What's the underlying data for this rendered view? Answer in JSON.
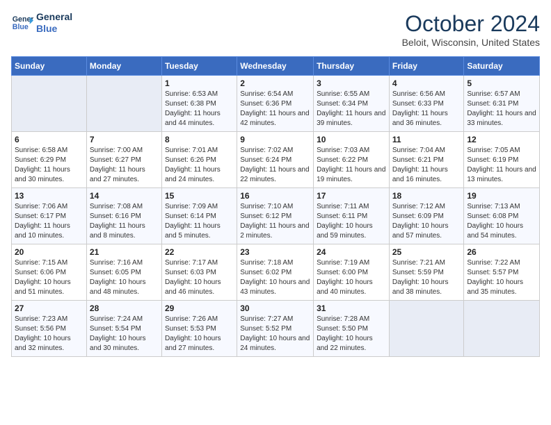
{
  "logo": {
    "line1": "General",
    "line2": "Blue"
  },
  "title": "October 2024",
  "location": "Beloit, Wisconsin, United States",
  "weekdays": [
    "Sunday",
    "Monday",
    "Tuesday",
    "Wednesday",
    "Thursday",
    "Friday",
    "Saturday"
  ],
  "weeks": [
    [
      {
        "day": "",
        "sunrise": "",
        "sunset": "",
        "daylight": ""
      },
      {
        "day": "",
        "sunrise": "",
        "sunset": "",
        "daylight": ""
      },
      {
        "day": "1",
        "sunrise": "Sunrise: 6:53 AM",
        "sunset": "Sunset: 6:38 PM",
        "daylight": "Daylight: 11 hours and 44 minutes."
      },
      {
        "day": "2",
        "sunrise": "Sunrise: 6:54 AM",
        "sunset": "Sunset: 6:36 PM",
        "daylight": "Daylight: 11 hours and 42 minutes."
      },
      {
        "day": "3",
        "sunrise": "Sunrise: 6:55 AM",
        "sunset": "Sunset: 6:34 PM",
        "daylight": "Daylight: 11 hours and 39 minutes."
      },
      {
        "day": "4",
        "sunrise": "Sunrise: 6:56 AM",
        "sunset": "Sunset: 6:33 PM",
        "daylight": "Daylight: 11 hours and 36 minutes."
      },
      {
        "day": "5",
        "sunrise": "Sunrise: 6:57 AM",
        "sunset": "Sunset: 6:31 PM",
        "daylight": "Daylight: 11 hours and 33 minutes."
      }
    ],
    [
      {
        "day": "6",
        "sunrise": "Sunrise: 6:58 AM",
        "sunset": "Sunset: 6:29 PM",
        "daylight": "Daylight: 11 hours and 30 minutes."
      },
      {
        "day": "7",
        "sunrise": "Sunrise: 7:00 AM",
        "sunset": "Sunset: 6:27 PM",
        "daylight": "Daylight: 11 hours and 27 minutes."
      },
      {
        "day": "8",
        "sunrise": "Sunrise: 7:01 AM",
        "sunset": "Sunset: 6:26 PM",
        "daylight": "Daylight: 11 hours and 24 minutes."
      },
      {
        "day": "9",
        "sunrise": "Sunrise: 7:02 AM",
        "sunset": "Sunset: 6:24 PM",
        "daylight": "Daylight: 11 hours and 22 minutes."
      },
      {
        "day": "10",
        "sunrise": "Sunrise: 7:03 AM",
        "sunset": "Sunset: 6:22 PM",
        "daylight": "Daylight: 11 hours and 19 minutes."
      },
      {
        "day": "11",
        "sunrise": "Sunrise: 7:04 AM",
        "sunset": "Sunset: 6:21 PM",
        "daylight": "Daylight: 11 hours and 16 minutes."
      },
      {
        "day": "12",
        "sunrise": "Sunrise: 7:05 AM",
        "sunset": "Sunset: 6:19 PM",
        "daylight": "Daylight: 11 hours and 13 minutes."
      }
    ],
    [
      {
        "day": "13",
        "sunrise": "Sunrise: 7:06 AM",
        "sunset": "Sunset: 6:17 PM",
        "daylight": "Daylight: 11 hours and 10 minutes."
      },
      {
        "day": "14",
        "sunrise": "Sunrise: 7:08 AM",
        "sunset": "Sunset: 6:16 PM",
        "daylight": "Daylight: 11 hours and 8 minutes."
      },
      {
        "day": "15",
        "sunrise": "Sunrise: 7:09 AM",
        "sunset": "Sunset: 6:14 PM",
        "daylight": "Daylight: 11 hours and 5 minutes."
      },
      {
        "day": "16",
        "sunrise": "Sunrise: 7:10 AM",
        "sunset": "Sunset: 6:12 PM",
        "daylight": "Daylight: 11 hours and 2 minutes."
      },
      {
        "day": "17",
        "sunrise": "Sunrise: 7:11 AM",
        "sunset": "Sunset: 6:11 PM",
        "daylight": "Daylight: 10 hours and 59 minutes."
      },
      {
        "day": "18",
        "sunrise": "Sunrise: 7:12 AM",
        "sunset": "Sunset: 6:09 PM",
        "daylight": "Daylight: 10 hours and 57 minutes."
      },
      {
        "day": "19",
        "sunrise": "Sunrise: 7:13 AM",
        "sunset": "Sunset: 6:08 PM",
        "daylight": "Daylight: 10 hours and 54 minutes."
      }
    ],
    [
      {
        "day": "20",
        "sunrise": "Sunrise: 7:15 AM",
        "sunset": "Sunset: 6:06 PM",
        "daylight": "Daylight: 10 hours and 51 minutes."
      },
      {
        "day": "21",
        "sunrise": "Sunrise: 7:16 AM",
        "sunset": "Sunset: 6:05 PM",
        "daylight": "Daylight: 10 hours and 48 minutes."
      },
      {
        "day": "22",
        "sunrise": "Sunrise: 7:17 AM",
        "sunset": "Sunset: 6:03 PM",
        "daylight": "Daylight: 10 hours and 46 minutes."
      },
      {
        "day": "23",
        "sunrise": "Sunrise: 7:18 AM",
        "sunset": "Sunset: 6:02 PM",
        "daylight": "Daylight: 10 hours and 43 minutes."
      },
      {
        "day": "24",
        "sunrise": "Sunrise: 7:19 AM",
        "sunset": "Sunset: 6:00 PM",
        "daylight": "Daylight: 10 hours and 40 minutes."
      },
      {
        "day": "25",
        "sunrise": "Sunrise: 7:21 AM",
        "sunset": "Sunset: 5:59 PM",
        "daylight": "Daylight: 10 hours and 38 minutes."
      },
      {
        "day": "26",
        "sunrise": "Sunrise: 7:22 AM",
        "sunset": "Sunset: 5:57 PM",
        "daylight": "Daylight: 10 hours and 35 minutes."
      }
    ],
    [
      {
        "day": "27",
        "sunrise": "Sunrise: 7:23 AM",
        "sunset": "Sunset: 5:56 PM",
        "daylight": "Daylight: 10 hours and 32 minutes."
      },
      {
        "day": "28",
        "sunrise": "Sunrise: 7:24 AM",
        "sunset": "Sunset: 5:54 PM",
        "daylight": "Daylight: 10 hours and 30 minutes."
      },
      {
        "day": "29",
        "sunrise": "Sunrise: 7:26 AM",
        "sunset": "Sunset: 5:53 PM",
        "daylight": "Daylight: 10 hours and 27 minutes."
      },
      {
        "day": "30",
        "sunrise": "Sunrise: 7:27 AM",
        "sunset": "Sunset: 5:52 PM",
        "daylight": "Daylight: 10 hours and 24 minutes."
      },
      {
        "day": "31",
        "sunrise": "Sunrise: 7:28 AM",
        "sunset": "Sunset: 5:50 PM",
        "daylight": "Daylight: 10 hours and 22 minutes."
      },
      {
        "day": "",
        "sunrise": "",
        "sunset": "",
        "daylight": ""
      },
      {
        "day": "",
        "sunrise": "",
        "sunset": "",
        "daylight": ""
      }
    ]
  ]
}
